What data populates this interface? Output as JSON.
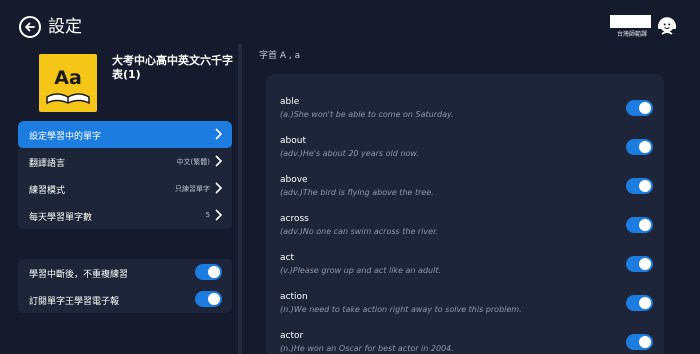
{
  "header": {
    "title": "設定",
    "account_label": "台灣師範課"
  },
  "book": {
    "title": "大考中心高中英文六千字表(1)",
    "cover_text": "Aa"
  },
  "menu": [
    {
      "label": "設定學習中的單字",
      "value": "",
      "active": true
    },
    {
      "label": "翻譯語言",
      "value": "中文(繁體)",
      "active": false
    },
    {
      "label": "練習模式",
      "value": "只練習單字",
      "active": false
    },
    {
      "label": "每天學習單字數",
      "value": "5",
      "active": false
    }
  ],
  "toggles": [
    {
      "label": "學習中斷後，不重複練習",
      "on": true
    },
    {
      "label": "訂閱單字王學習電子報",
      "on": true
    }
  ],
  "section_header": "字首 A , a",
  "words": [
    {
      "word": "able",
      "example": "(a.)She won't be able to come on Saturday.",
      "on": true
    },
    {
      "word": "about",
      "example": "(adv.)He's about 20 years old now.",
      "on": true
    },
    {
      "word": "above",
      "example": "(adv.)The bird is flying above the tree.",
      "on": true
    },
    {
      "word": "across",
      "example": "(adv.)No one can swim across the river.",
      "on": true
    },
    {
      "word": "act",
      "example": "(v.)Please grow up and act like an adult.",
      "on": true
    },
    {
      "word": "action",
      "example": "(n.)We need to take action right away to solve this problem.",
      "on": true
    },
    {
      "word": "actor",
      "example": "(n.)He won an Oscar for best actor in 2004.",
      "on": true
    }
  ],
  "colors": {
    "background": "#151b2d",
    "card": "#1e2538",
    "accent": "#1c7ce0",
    "cover": "#f5c518"
  }
}
